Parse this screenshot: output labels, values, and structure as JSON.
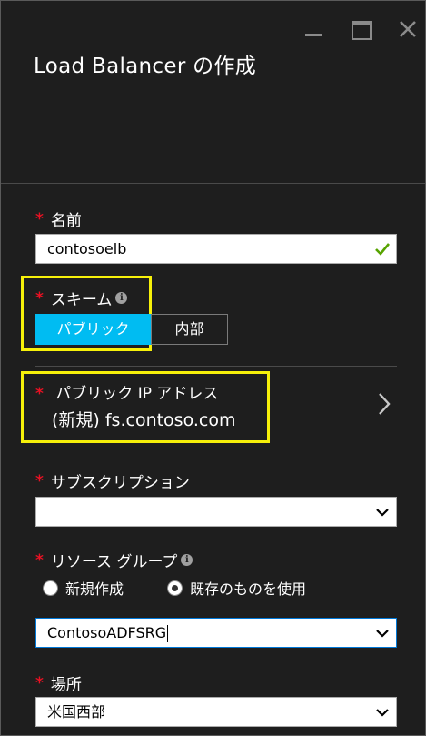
{
  "window": {
    "title": "Load Balancer の作成"
  },
  "form": {
    "name": {
      "label": "名前",
      "value": "contosoelb"
    },
    "scheme": {
      "label": "スキーム",
      "options": [
        "パブリック",
        "内部"
      ],
      "selected": "パブリック"
    },
    "public_ip": {
      "label": "パブリック IP アドレス",
      "value": "(新規) fs.contoso.com"
    },
    "subscription": {
      "label": "サブスクリプション",
      "value": ""
    },
    "resource_group": {
      "label": "リソース グループ",
      "radio_new": "新規作成",
      "radio_existing": "既存のものを使用",
      "selected": "既存のものを使用",
      "value": "ContosoADFSRG"
    },
    "location": {
      "label": "場所",
      "value": "米国西部"
    }
  },
  "colors": {
    "background": "#1e1e1e",
    "required": "#e81123",
    "accent": "#00bcf2",
    "highlight": "#f6f00a",
    "valid": "#57a300"
  },
  "icons": [
    "minimize-icon",
    "maximize-icon",
    "close-icon",
    "check-icon",
    "info-icon",
    "chevron-right-icon",
    "chevron-down-icon"
  ]
}
